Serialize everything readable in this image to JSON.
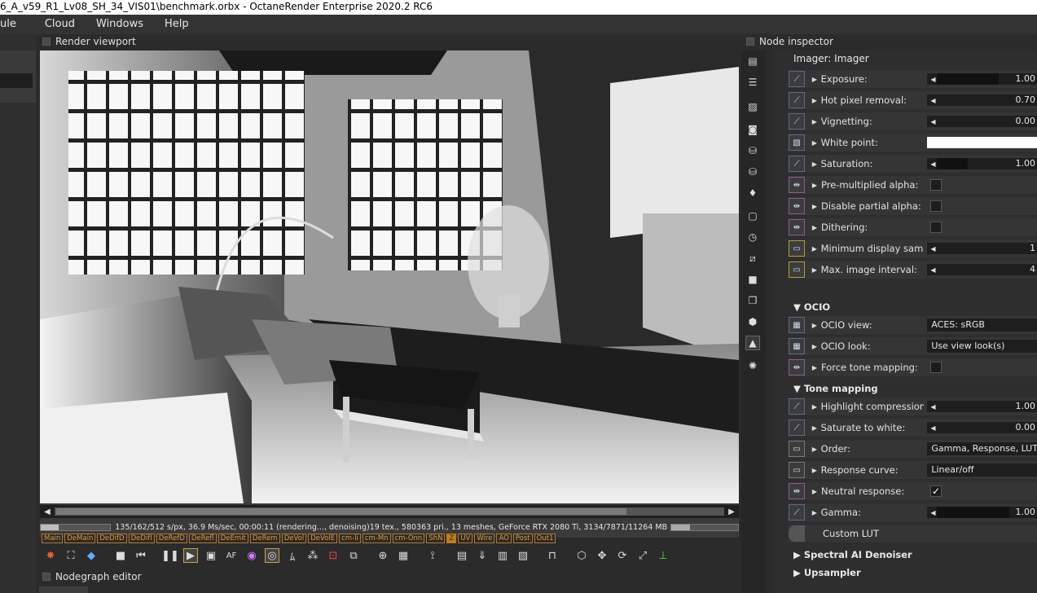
{
  "window": {
    "title": "6_A_v59_R1_Lv08_SH_34_VIS01\\benchmark.orbx - OctaneRender Enterprise 2020.2 RC6"
  },
  "menubar": {
    "items": [
      "ule",
      "Cloud",
      "Windows",
      "Help"
    ]
  },
  "viewport": {
    "title": "Render viewport",
    "render_stats": "135/162/512 s/px, 36.9 Ms/sec, 00:00:11 (rendering..., denoising)",
    "render_progress": 0.26,
    "gpu_info": "19 tex., 580363 pri., 13 meshes, GeForce RTX 2080 Ti, 3134/7871/11264 MB",
    "gpu_mem_progress": 0.28,
    "passes": [
      "Main",
      "DeMain",
      "DeDifD",
      "DeDifI",
      "DeRefD",
      "DeRefl",
      "DeEmit",
      "DeRem",
      "DeVol",
      "DeVolE",
      "cm-li",
      "cm-Mn",
      "cm-Onn",
      "ShN",
      "Z",
      "UV",
      "Wire",
      "AO",
      "Post",
      "Out1"
    ],
    "active_pass": "Z",
    "toolbar_icons": [
      "fire-icon",
      "region-icon",
      "cube-color-icon",
      "stop-icon",
      "restart-icon",
      "pause-icon",
      "play-icon",
      "display-icon",
      "af-icon",
      "color-wheel-icon",
      "focus-icon",
      "white-balance-icon",
      "material-picker-icon",
      "object-picker-icon",
      "zoom-icon",
      "checker-icon",
      "lens-icon",
      "clay-icon",
      "save-icon",
      "export-icon",
      "image-icon",
      "lock-icon",
      "viewcube-icon",
      "move-icon",
      "rotate-icon",
      "fit-icon",
      "axis-icon"
    ]
  },
  "nodegraph": {
    "title": "Nodegraph editor"
  },
  "inspector": {
    "title": "Node inspector",
    "node_title": "Imager: Imager",
    "rows": [
      {
        "label": "Exposure:",
        "type": "slider",
        "value": "1.00",
        "fill": 0.6,
        "icon": "curve-icon"
      },
      {
        "label": "Hot pixel removal:",
        "type": "slider",
        "value": "0.70",
        "fill": 0.0,
        "icon": "curve-icon"
      },
      {
        "label": "Vignetting:",
        "type": "slider",
        "value": "0.00",
        "fill": 0.0,
        "icon": "curve-icon"
      },
      {
        "label": "White point:",
        "type": "color",
        "value": "#ffffff",
        "icon": "color-swatch-icon"
      },
      {
        "label": "Saturation:",
        "type": "slider",
        "value": "1.00",
        "fill": 0.3,
        "icon": "curve-icon"
      },
      {
        "label": "Pre-multiplied alpha:",
        "type": "checkbox",
        "checked": false,
        "icon": "toggle-icon"
      },
      {
        "label": "Disable partial alpha:",
        "type": "checkbox",
        "checked": false,
        "icon": "toggle-icon"
      },
      {
        "label": "Dithering:",
        "type": "checkbox",
        "checked": false,
        "icon": "toggle-icon"
      },
      {
        "label": "Minimum display samples:",
        "type": "slider",
        "value": "1",
        "fill": 0.0,
        "icon": "int-icon"
      },
      {
        "label": "Max. image interval:",
        "type": "slider",
        "value": "4",
        "fill": 0.0,
        "icon": "int-icon"
      }
    ],
    "sections": {
      "ocio": "▼ OCIO",
      "tone_mapping": "▼ Tone mapping",
      "spectral": "▶ Spectral AI Denoiser",
      "upsampler": "▶ Upsampler"
    },
    "ocio_rows": [
      {
        "label": "OCIO view:",
        "type": "combo",
        "value": "ACES: sRGB",
        "icon": "ocio-view-icon"
      },
      {
        "label": "OCIO look:",
        "type": "combo",
        "value": "Use view look(s)",
        "icon": "ocio-look-icon"
      },
      {
        "label": "Force tone mapping:",
        "type": "checkbox",
        "checked": false,
        "icon": "toggle-icon"
      }
    ],
    "tone_rows": [
      {
        "label": "Highlight compression:",
        "type": "slider",
        "value": "1.00",
        "fill": 0.0,
        "icon": "curve-icon"
      },
      {
        "label": "Saturate to white:",
        "type": "slider",
        "value": "0.00",
        "fill": 0.0,
        "icon": "curve-icon"
      },
      {
        "label": "Order:",
        "type": "combo",
        "value": "Gamma, Response, LUT",
        "icon": "enum-icon"
      },
      {
        "label": "Response curve:",
        "type": "combo",
        "value": "Linear/off",
        "icon": "enum-icon"
      },
      {
        "label": "Neutral response:",
        "type": "checkbox",
        "checked": true,
        "icon": "toggle-icon"
      },
      {
        "label": "Gamma:",
        "type": "slider",
        "value": "1.00",
        "fill": 0.7,
        "icon": "curve-icon"
      }
    ],
    "custom_lut": "Custom LUT",
    "check_glyph": "✓"
  }
}
